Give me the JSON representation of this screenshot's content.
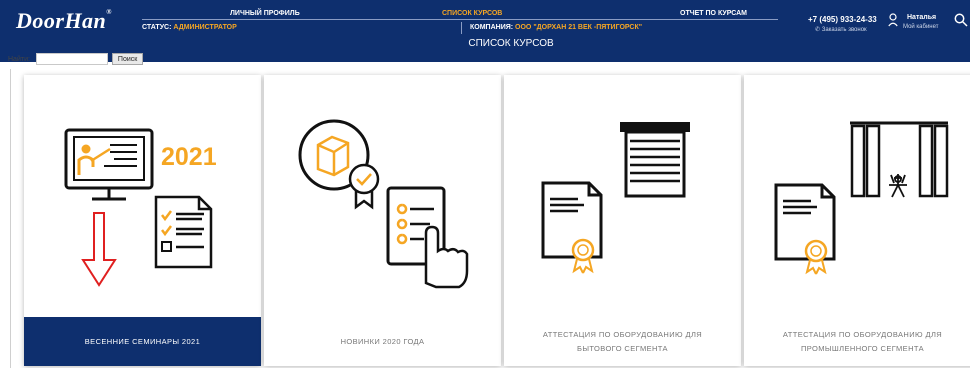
{
  "header": {
    "logo": "DoorHan",
    "nav": [
      "Личный профиль",
      "Список курсов",
      "Отчет по курсам"
    ],
    "status_label": "Статус:",
    "status_value": "Администратор",
    "company_label": "Компания:",
    "company_value": "ООО \"Дорхан 21 век -Пятигорск\"",
    "phone": "+7 (495) 933-24-33",
    "callback": "Заказать звонок",
    "user_name": "Наталья",
    "cabinet": "Мой кабинет",
    "page_title": "Список курсов"
  },
  "search": {
    "label": "Найти:",
    "value": "",
    "placeholder": "",
    "button": "Поиск"
  },
  "courses": [
    {
      "title": "Весенние семинары 2021",
      "year": "2021"
    },
    {
      "title": "Новинки 2020 года"
    },
    {
      "title": "Аттестация по оборудованию для бытового сегмента"
    },
    {
      "title": "Аттестация по оборудованию для промышленного сегмента"
    }
  ],
  "colors": {
    "header_bg": "#0e2f6e",
    "accent": "#f5a623",
    "arrow": "#e02020"
  }
}
